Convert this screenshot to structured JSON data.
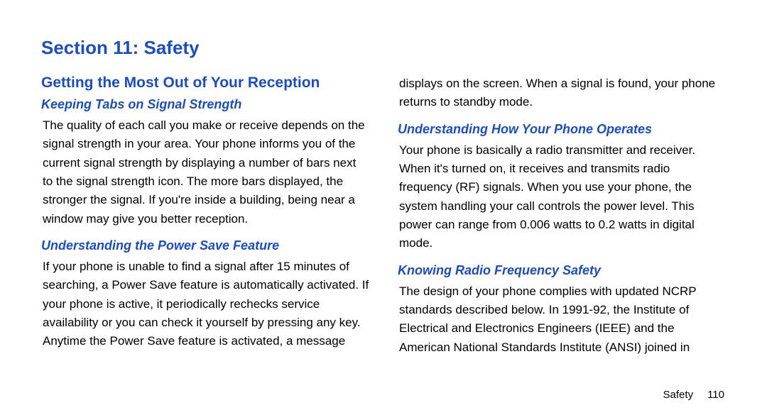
{
  "section_title": "Section 11: Safety",
  "left": {
    "heading": "Getting the Most Out of Your Reception",
    "sub1": {
      "title": "Keeping Tabs on Signal Strength",
      "body": "The quality of each call you make or receive depends on the signal strength in your area. Your phone informs you of the current signal strength by displaying a number of bars next to the signal strength icon. The more bars displayed, the stronger the signal. If you're inside a building, being near a window may give you better reception."
    },
    "sub2": {
      "title": "Understanding the Power Save Feature",
      "body": "If your phone is unable to find a signal after 15 minutes of searching, a Power Save feature is automatically activated. If your phone is active, it periodically rechecks service availability or you can check it yourself by pressing any key. Anytime the Power Save feature is activated, a message"
    }
  },
  "right": {
    "intro": "displays on the screen. When a signal is found, your phone returns to standby mode.",
    "sub1": {
      "title": "Understanding How Your Phone Operates",
      "body": "Your phone is basically a radio transmitter and receiver. When it's turned on, it receives and transmits radio frequency (RF) signals. When you use your phone, the system handling your call controls the power level. This power can range from 0.006 watts to 0.2 watts in digital mode."
    },
    "sub2": {
      "title": "Knowing Radio Frequency Safety",
      "body": "The design of your phone complies with updated NCRP standards described below. In 1991-92, the Institute of Electrical and Electronics Engineers (IEEE) and the American National Standards Institute (ANSI) joined in"
    }
  },
  "footer": {
    "label": "Safety",
    "page": "110"
  }
}
